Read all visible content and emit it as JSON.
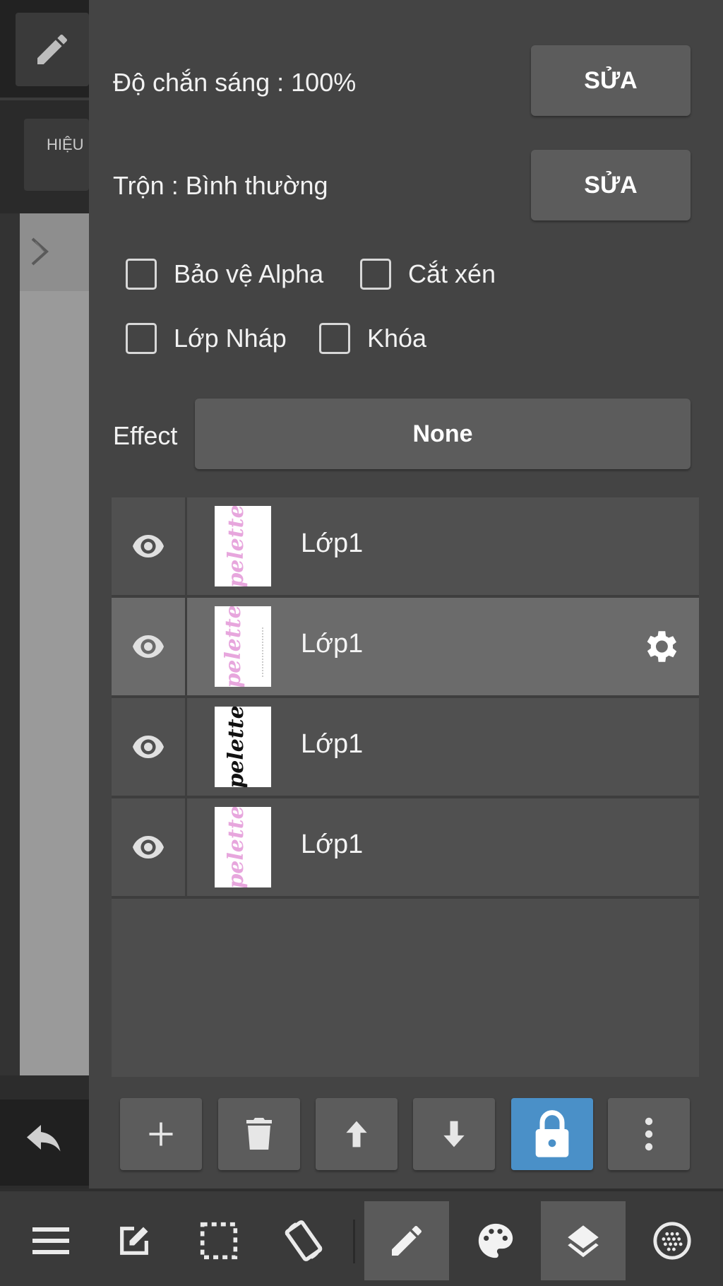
{
  "left_strip": {
    "effect_tab_label": "HIỆU"
  },
  "layer_properties": {
    "opacity_label": "Độ chắn sáng : 100%",
    "opacity_edit": "SỬA",
    "blend_label": "Trộn : Bình thường",
    "blend_edit": "SỬA",
    "checkboxes": [
      {
        "label": "Bảo vệ Alpha",
        "checked": false
      },
      {
        "label": "Cắt xén",
        "checked": false
      },
      {
        "label": "Lớp Nháp",
        "checked": false
      },
      {
        "label": "Khóa",
        "checked": false
      }
    ],
    "effect_label": "Effect",
    "effect_value": "None"
  },
  "layers": [
    {
      "name": "Lớp1",
      "visible": true,
      "selected": false,
      "thumb": "pink"
    },
    {
      "name": "Lớp1",
      "visible": true,
      "selected": true,
      "thumb": "pink"
    },
    {
      "name": "Lớp1",
      "visible": true,
      "selected": false,
      "thumb": "black"
    },
    {
      "name": "Lớp1",
      "visible": true,
      "selected": false,
      "thumb": "pink"
    }
  ],
  "layer_toolbar": {
    "buttons": [
      "add-layer",
      "delete-layer",
      "move-layer-up",
      "move-layer-down",
      "lock",
      "more"
    ],
    "active": "lock"
  },
  "bottom_nav": {
    "items": [
      "menu",
      "edit",
      "selection",
      "rotate-canvas",
      "brush",
      "color-palette",
      "layers",
      "materials"
    ],
    "active": [
      "brush",
      "layers"
    ]
  },
  "colors": {
    "panel_bg": "#444444",
    "button_bg": "#5c5c5c",
    "selected_row": "#6b6b6b",
    "accent_blue": "#4a90c8",
    "thumb_pink": "#e7a6dd"
  }
}
